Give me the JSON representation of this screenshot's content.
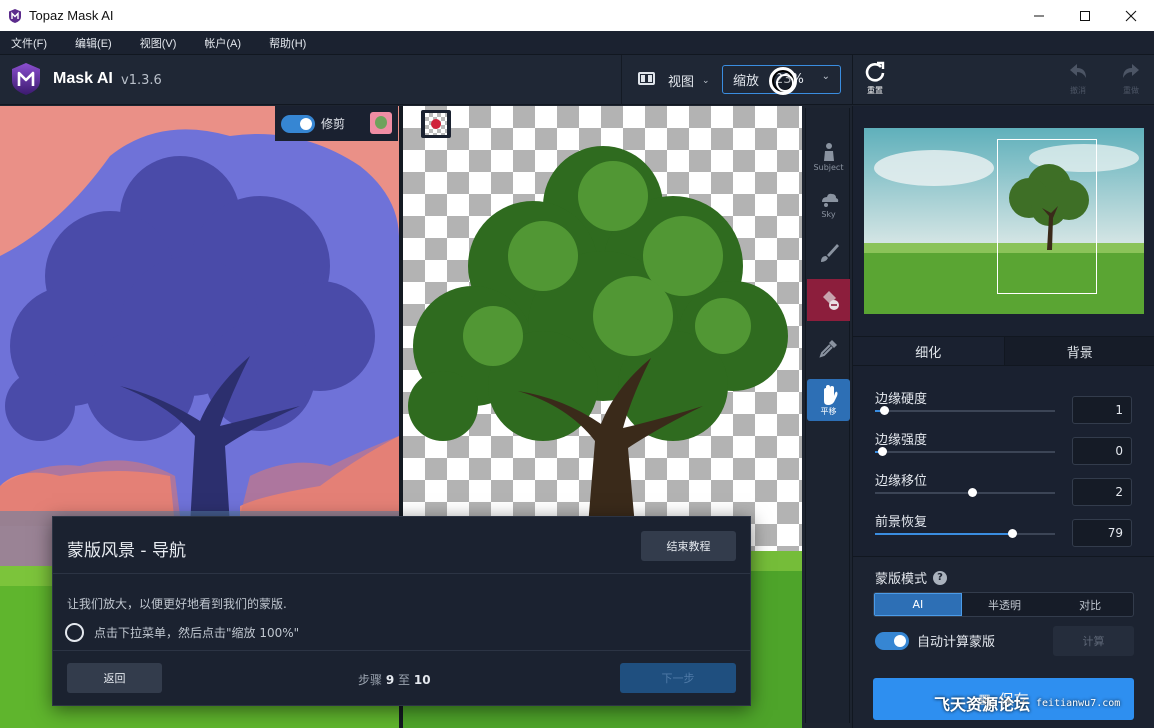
{
  "window": {
    "title": "Topaz Mask AI",
    "controls": [
      "minimize",
      "maximize",
      "close"
    ]
  },
  "menubar": {
    "items": [
      {
        "label": "文件(F)"
      },
      {
        "label": "编辑(E)"
      },
      {
        "label": "视图(V)"
      },
      {
        "label": "帐户(A)"
      },
      {
        "label": "帮助(H)"
      }
    ]
  },
  "toolbar": {
    "product": "Mask AI",
    "version": "v1.3.6",
    "view_label": "视图",
    "zoom_label": "缩放",
    "zoom_value": "23%"
  },
  "actions": {
    "reset": "重置",
    "undo": "撤消",
    "redo": "重做"
  },
  "canvas": {
    "trim_label": "修剪"
  },
  "tools": [
    {
      "label": "Subject",
      "icon": "subject-icon"
    },
    {
      "label": "Sky",
      "icon": "sky-icon"
    },
    {
      "label": "",
      "icon": "brush-icon"
    },
    {
      "label": "",
      "icon": "fill-erase-icon"
    },
    {
      "label": "",
      "icon": "eyedropper-icon"
    },
    {
      "label": "平移",
      "icon": "hand-icon",
      "active": true
    }
  ],
  "panel": {
    "tabs": [
      {
        "label": "细化",
        "active": true
      },
      {
        "label": "背景",
        "active": false
      }
    ],
    "sliders": [
      {
        "label": "边缘硬度",
        "value": "1",
        "fraction": 0.05
      },
      {
        "label": "边缘强度",
        "value": "0",
        "fraction": 0.04
      },
      {
        "label": "边缘移位",
        "value": "2",
        "fraction": 0.54
      },
      {
        "label": "前景恢复",
        "value": "79",
        "fraction": 0.76
      }
    ],
    "mask_mode_label": "蒙版模式",
    "mask_modes": [
      {
        "label": "AI",
        "active": true
      },
      {
        "label": "半透明",
        "active": false
      },
      {
        "label": "对比",
        "active": false
      }
    ],
    "auto_compute_label": "自动计算蒙版",
    "compute_label": "计算",
    "save_label": "保存"
  },
  "dialog": {
    "title": "蒙版风景 - 导航",
    "end_tutorial": "结束教程",
    "text": "让我们放大，以便更好地看到我们的蒙版.",
    "step_instruction": "点击下拉菜单，然后点击\"缩放 100%\"",
    "back": "返回",
    "steps_prefix": "步骤",
    "steps_current": "9",
    "steps_mid": "至",
    "steps_total": "10",
    "next": "下一步"
  },
  "watermark": {
    "text": "飞天资源论坛",
    "url": "feitianwu7.com"
  },
  "colors": {
    "accent": "#2e8ff0",
    "panel_bg": "#1a2130",
    "mask_red": "#e9877e",
    "mask_blue": "#6f72d8",
    "erase_tool": "#8c1e3c"
  }
}
